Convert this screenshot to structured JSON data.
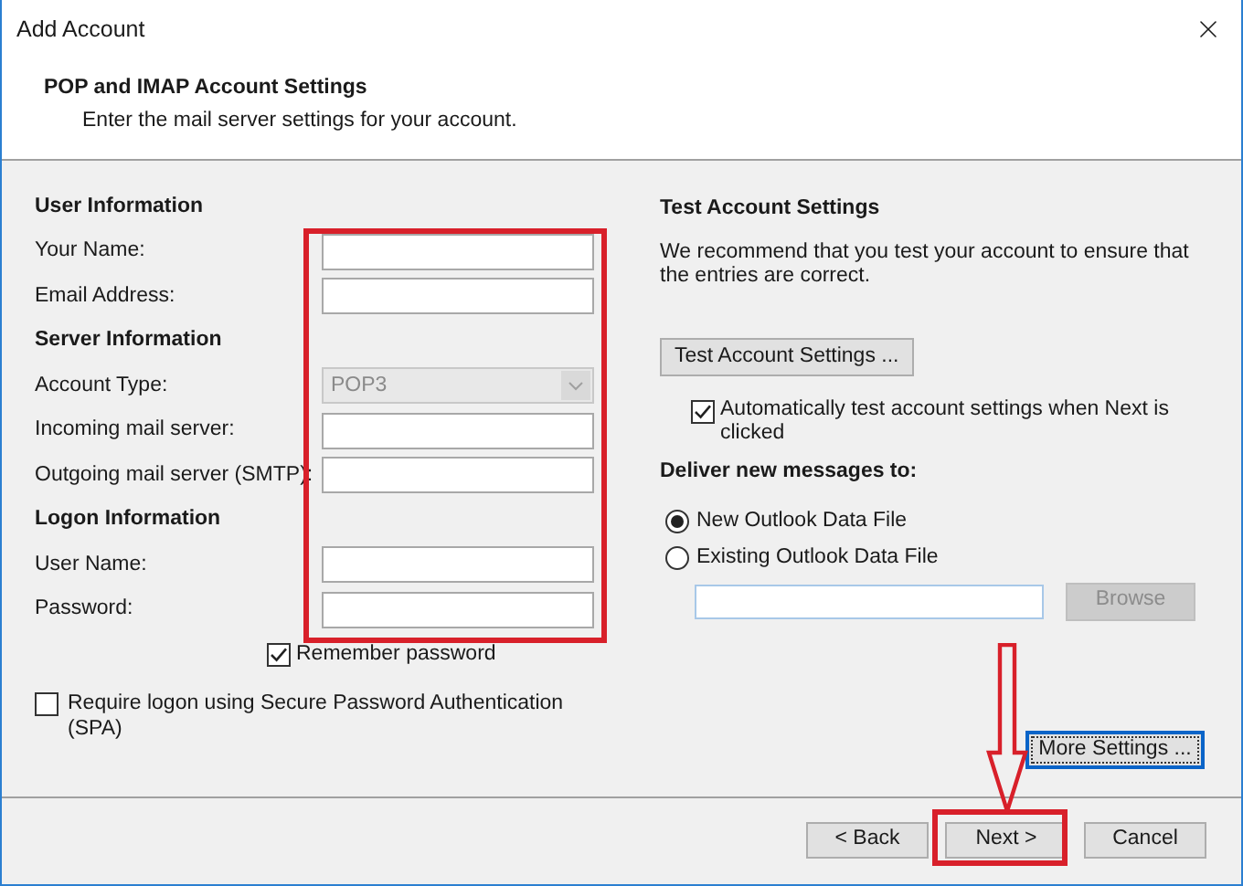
{
  "window": {
    "title": "Add Account"
  },
  "header": {
    "title": "POP and IMAP Account Settings",
    "subtitle": "Enter the mail server settings for your account."
  },
  "left": {
    "rows": [
      {
        "kind": "heading",
        "text": "User Information"
      },
      {
        "kind": "field",
        "label": "Your Name:"
      },
      {
        "kind": "field",
        "label": "Email Address:"
      },
      {
        "kind": "heading",
        "text": "Server Information"
      },
      {
        "kind": "dropdown",
        "label": "Account Type:",
        "value": "POP3",
        "disabled": true
      },
      {
        "kind": "field",
        "label": "Incoming mail server:"
      },
      {
        "kind": "field",
        "label": "Outgoing mail server (SMTP):"
      },
      {
        "kind": "heading",
        "text": "Logon Information"
      },
      {
        "kind": "field",
        "label": "User Name:"
      },
      {
        "kind": "field",
        "label": "Password:"
      }
    ],
    "remember_password": {
      "label": "Remember password",
      "checked": true
    },
    "spa": {
      "label": "Require logon using Secure Password Authentication (SPA)",
      "checked": false
    }
  },
  "right": {
    "title": "Test Account Settings",
    "text": "We recommend that you test your account to ensure that the entries are correct.",
    "test_button": "Test Account Settings ...",
    "auto_test": {
      "label": "Automatically test account settings when Next is clicked",
      "checked": true
    },
    "deliver_label": "Deliver new messages to:",
    "deliver_options": [
      {
        "label": "New Outlook Data File",
        "selected": true
      },
      {
        "label": "Existing Outlook Data File",
        "selected": false
      }
    ],
    "browse_button": {
      "label": "Browse",
      "disabled": true
    },
    "more_settings_button": {
      "label": "More Settings ...",
      "focused": true
    }
  },
  "buttons": [
    {
      "label": "< Back"
    },
    {
      "label": "Next >"
    },
    {
      "label": "Cancel"
    }
  ]
}
